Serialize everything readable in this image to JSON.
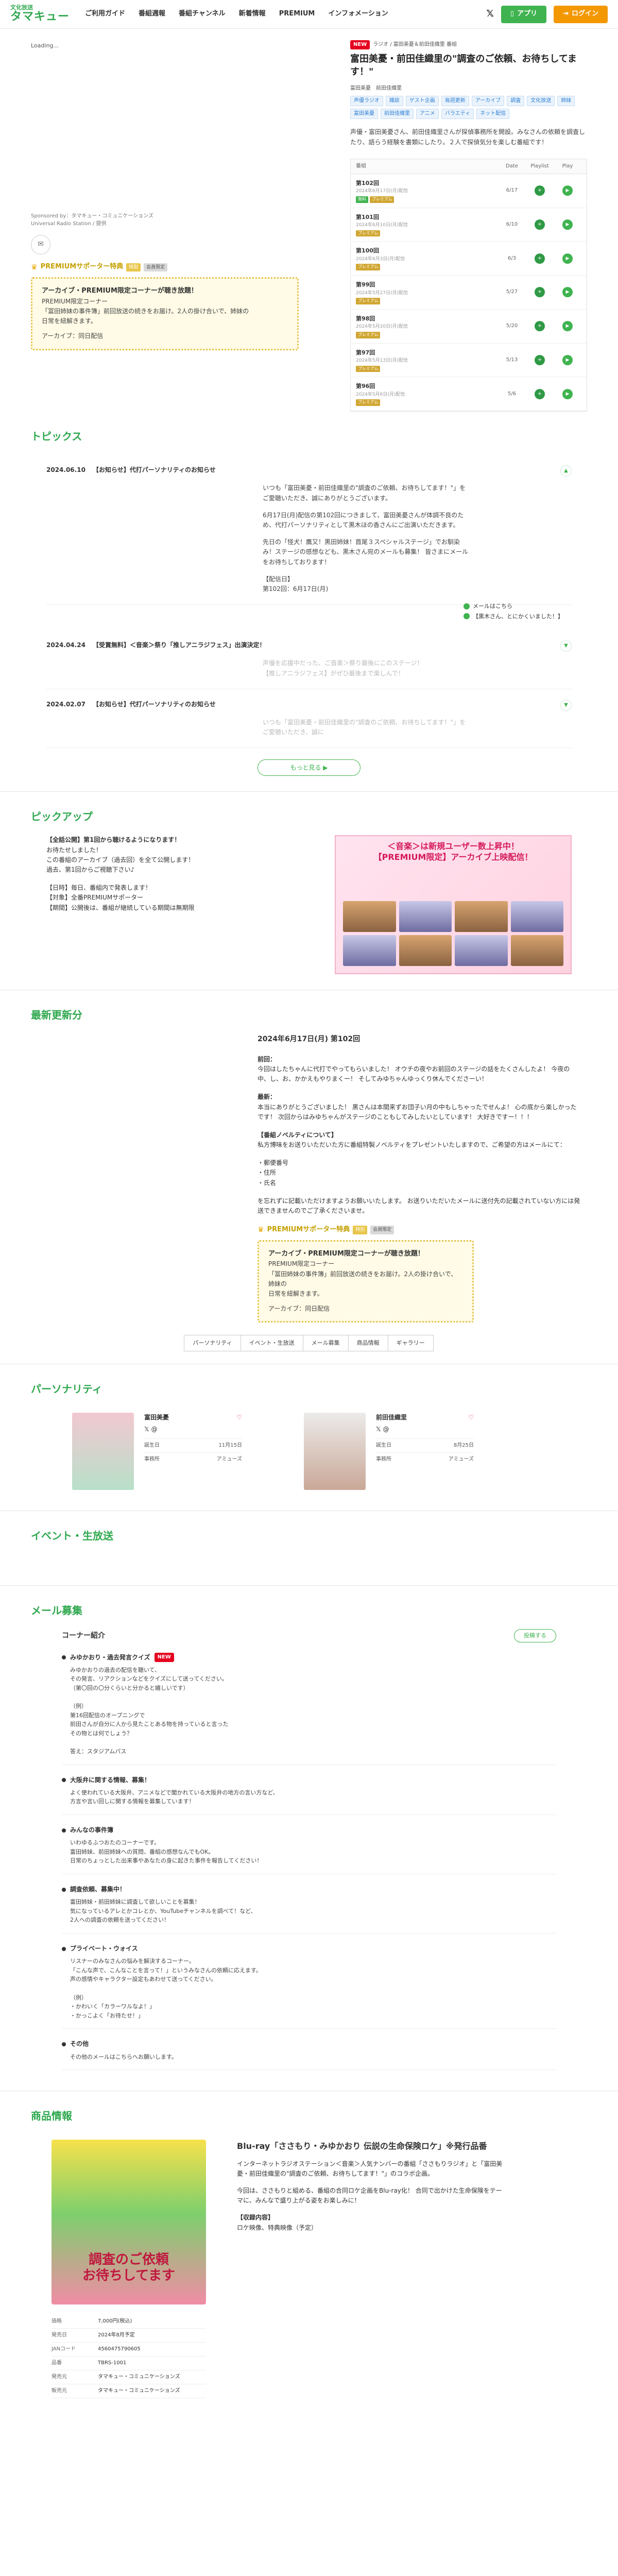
{
  "header": {
    "logo_top": "文化放送",
    "logo_main": "タマキュー",
    "nav": [
      "ご利用ガイド",
      "番組週報",
      "番組チャンネル",
      "新着情報",
      "PREMIUM",
      "インフォメーション"
    ],
    "x_label": "𝕏",
    "app_label": "アプリ",
    "login_label": "ログイン"
  },
  "player": {
    "loading": "Loading...",
    "sponsor_1": "Sponsored by：タマキュー・コミュニケーションズ",
    "sponsor_2": "Universal Radio Station / 提供"
  },
  "premium_supporter": {
    "label": "PREMIUMサポーター特典",
    "badge_a": "特別",
    "badge_b": "会員限定",
    "box_title": "アーカイブ・PREMIUM限定コーナーが聴き放題！",
    "box_lines": [
      "PREMIUM限定コーナー",
      "「冨田姉妹の事件簿」前回放送の続きをお届け。2人の掛け合いで、姉妹の",
      "日常を紐解きます。",
      "アーカイブ：同日配信"
    ]
  },
  "program": {
    "badge": "NEW",
    "sub": "ラジオ / 富田美憂＆前田佳織里 番組",
    "title": "富田美憂・前田佳織里の\"調査のご依頼、お待ちしてます！\"",
    "cast_label": "富田美憂　前田佳織里",
    "tags": [
      "声優ラジオ",
      "雑談",
      "ゲスト企画",
      "毎週更新",
      "アーカイブ",
      "調査",
      "文化放送",
      "姉妹",
      "富田美憂",
      "前田佳織里",
      "アニメ",
      "バラエティ",
      "ネット配信"
    ],
    "desc": "声優・富田美憂さん、前田佳織里さんが探偵事務所を開設。みなさんの依頼を調査したり、語らう経験を書類にしたり。２人で探偵気分を楽しむ番組です！",
    "table_head": [
      "番組",
      "Date",
      "Playlist",
      "Play"
    ],
    "episodes": [
      {
        "title": "第102回",
        "sub": "2024年6月17日(月)配信",
        "b1": "無料",
        "b2": "プレミアム",
        "date": "6/17"
      },
      {
        "title": "第101回",
        "sub": "2024年6月10日(月)配信",
        "b1": "プレミアム",
        "b2": "",
        "date": "6/10"
      },
      {
        "title": "第100回",
        "sub": "2024年6月3日(月)配信",
        "b1": "プレミアム",
        "b2": "",
        "date": "6/3"
      },
      {
        "title": "第99回",
        "sub": "2024年5月27日(月)配信",
        "b1": "プレミアム",
        "b2": "",
        "date": "5/27"
      },
      {
        "title": "第98回",
        "sub": "2024年5月20日(月)配信",
        "b1": "プレミアム",
        "b2": "",
        "date": "5/20"
      },
      {
        "title": "第97回",
        "sub": "2024年5月13日(月)配信",
        "b1": "プレミアム",
        "b2": "",
        "date": "5/13"
      },
      {
        "title": "第96回",
        "sub": "2024年5月6日(月)配信",
        "b1": "プレミアム",
        "b2": "",
        "date": "5/6"
      }
    ]
  },
  "topics": {
    "title": "トピックス",
    "items": [
      {
        "date": "2024.06.10",
        "title": "【お知らせ】代打パーソナリティのお知らせ",
        "body": [
          "いつも「富田美憂・前田佳織里の\"調査のご依頼、お待ちしてます！\"」をご愛聴いただき、誠にありがとうございます。",
          "6月17日(月)配信の第102回につきまして、富田美憂さんが体調不良のため、代打パーソナリティとして黒木ほの香さんにご出演いただきます。",
          "先日の「怪犬！鷹又！黒田姉妹！首尾３スペシャルステージ」でお馴染み！ステージの感想なども、黒木さん宛のメールも募集！ 皆さまにメールをお待ちしております！",
          "【配信日】",
          "第102回：6月17日(月)"
        ],
        "link_1": "メールはこちら",
        "link_2": "【黒木さん、とにかくいました！】"
      },
      {
        "date": "2024.04.24",
        "title": "【受賞無料】＜音楽＞祭り「推しアニラジフェス」出演決定！",
        "body": [
          "声優を応援中だった、ご音楽＞祭り最後にこのステージ！",
          "【推しアニラジフェス】がぜひ最後まで楽しんで！"
        ],
        "link_1": "",
        "link_2": ""
      },
      {
        "date": "2024.02.07",
        "title": "【お知らせ】代打パーソナリティのお知らせ",
        "body": [
          "いつも「富田美憂・前田佳織里の\"調査のご依頼、お待ちしてます！\"」をご愛聴いただき、誠に"
        ],
        "link_1": "",
        "link_2": ""
      }
    ],
    "more_label": "もっと見る ▶"
  },
  "pickup": {
    "title": "ピックアップ",
    "text_title": "【全話公開】第1回から聴けるようになります！",
    "lines": [
      "お待たせしました！",
      "この番組のアーカイブ（過去回）を全て公開します！",
      "過去、第1回からご視聴下さい♪",
      "",
      "【日時】毎日、番組内で発表します！",
      "【対象】全番PREMIUMサポーター",
      "【期間】公開後は、番組が継続している期間は無期限"
    ],
    "banner_line_1": "＜音楽＞は新規ユーザー数上昇中！",
    "banner_line_2": "【PREMIUM限定】アーカイブ上映配信！"
  },
  "latest": {
    "title": "最新更新分",
    "ep_title": "2024年6月17日(月) 第102回",
    "label_1": "前回：",
    "body_1": "今回はしたちゃんに代打でやってもらいました！ オウチの夜やお前回のステージの話をたくさんしたよ！ 今夜の中、し、お、かかえもやりまくー！ そしてみゆちゃんゆっくり休んでくださーい！",
    "label_2": "最新：",
    "body_2": "本当にありがとうございました！ 黒さんは本間来ずお団子い月の中もしちゃったでせんよ！ 心の底から楽しかったです！ 次回からはみゆちゃんがステージのこともしてみしたいとしています！ 大好きですー！！！",
    "label_3": "【番組ノベルティについて】",
    "body_3": "私方博味をお送りいただいた方に番組特製ノベルティをプレゼントいたしますので、ご希望の方はメールにて：",
    "list": [
      "・郵便番号",
      "・住所",
      "・氏名"
    ],
    "body_4": "を忘れずに記載いただけますようお願いいたします。 お送りいただいたメールに送付先の記載されていない方には発送できませんのでご了承くださいませ。"
  },
  "premium_supporter_2": {
    "box_title": "アーカイブ・PREMIUM限定コーナーが聴き放題！",
    "box_lines": [
      "PREMIUM限定コーナー",
      "「冨田姉妹の事件簿」前回放送の続きをお届け。2人の掛け合いで、姉妹の",
      "日常を紐解きます。",
      "アーカイブ：同日配信"
    ]
  },
  "tabs": [
    "パーソナリティ",
    "イベント・生放送",
    "メール募集",
    "商品情報",
    "ギャラリー"
  ],
  "personality": {
    "title": "パーソナリティ",
    "people": [
      {
        "name": "富田美憂",
        "x": "𝕏 @",
        "k1": "誕生日",
        "v1": "11月15日",
        "k2": "事務所",
        "v2": "アミューズ"
      },
      {
        "name": "前田佳織里",
        "x": "𝕏 @",
        "k1": "誕生日",
        "v1": "8月25日",
        "k2": "事務所",
        "v2": "アミューズ"
      }
    ]
  },
  "events": {
    "title": "イベント・生放送"
  },
  "mail": {
    "title": "メール募集",
    "corner_intro": "コーナー紹介",
    "post_label": "投稿する",
    "corners": [
      {
        "name": "みゆかおり・過去発言クイズ",
        "body": "みゆかおりの過去の配信を聴いて、\nその発言、リアクションなどをクイズにして送ってください。\n（第〇回の〇分くらいと分かると嬉しいです）\n\n（例）\n第16回配信のオープニングで\n前田さんが自分に人から見たことある物を持っていると言った\nその物とは何でしょう？\n\n答え：スタジアムパス"
      },
      {
        "name": "大阪弁に関する情報、募集！",
        "body": "よく使われている大阪弁、アニメなどで聞かれている大阪弁の地方の言い方など、\n方言や言い回しに関する情報を募集しています！"
      },
      {
        "name": "みんなの事件簿",
        "body": "いわゆるふつおたのコーナーです。\n富田姉妹、前田姉妹への質問、番組の感想なんでもOK。\n日常のちょっとした出来事やあなたの身に起きた事件を報告してください！"
      },
      {
        "name": "調査依頼、募集中！",
        "body": "富田姉妹・前田姉妹に調査して欲しいことを募集！\n気になっているアレとかコレとか、YouTubeチャンネルを調べて！など、\n2人への調査の依頼を送ってください！"
      },
      {
        "name": "プライベート・ウォイス",
        "body": "リスナーのみなさんの悩みを解決するコーナー。\n「こんな声で、こんなことを言って！」というみなさんの依頼に応えます。\n声の感情やキャラクター設定もあわせて送ってください。\n\n（例）\n・かわいく「カラーワルなよ！」\n・かっこよく「お待たせ！」"
      },
      {
        "name": "その他",
        "body": "その他のメールはこちらへお願いします。"
      }
    ]
  },
  "product": {
    "title": "商品情報",
    "img_label": "調査のご依頼\nお待ちしてます",
    "name": "Blu-ray「ささもり・みゆかおり 伝説の生命保険ロケ」※発行品番",
    "desc_1": "インターネットラジオステーション＜音楽＞人気ナンバーの番組「ささもりラジオ」と「富田美憂・前田佳織里の\"調査のご依頼、お待ちしてます！\"」のコラボ企画。",
    "desc_2": "今回は、ささもりと組める、番組の合同ロケ企画をBlu-ray化！ 合同で出かけた生命保険をテーマに、みんなで盛り上がる姿をお楽しみに！",
    "desc_3": "【収録内容】",
    "desc_4": "ロケ映像、特典映像（予定）",
    "spec": [
      {
        "k": "価格",
        "v": "7,000円(税込)"
      },
      {
        "k": "発売日",
        "v": "2024年8月予定"
      },
      {
        "k": "JANコード",
        "v": "4560475790605"
      },
      {
        "k": "品番",
        "v": "TBRS-1001"
      },
      {
        "k": "発売元",
        "v": "タマキュー・コミュニケーションズ"
      },
      {
        "k": "販売元",
        "v": "タマキュー・コミュニケーションズ"
      }
    ]
  }
}
